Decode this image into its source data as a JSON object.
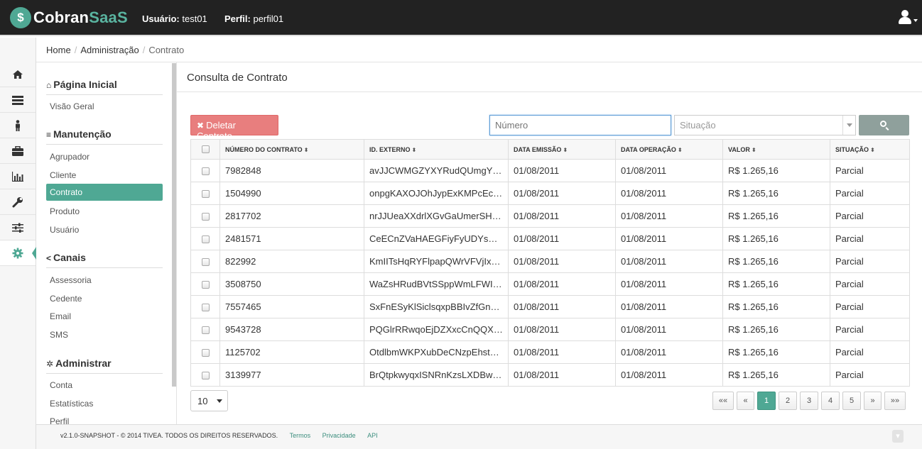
{
  "header": {
    "brand_left": "Cobran",
    "brand_right": "SaaS",
    "user_label": "Usuário:",
    "user_value": "test01",
    "profile_label": "Perfil:",
    "profile_value": "perfil01"
  },
  "rail": {
    "icons": [
      "home-icon",
      "server-icon",
      "person-icon",
      "briefcase-icon",
      "bar-chart-icon",
      "wrench-icon",
      "sliders-icon",
      "gear-icon"
    ]
  },
  "breadcrumb": {
    "home": "Home",
    "admin": "Administração",
    "current": "Contrato"
  },
  "sidebar": {
    "sec1": "Página Inicial",
    "sec1_items": [
      "Visão Geral"
    ],
    "sec2": "Manutenção",
    "sec2_items": [
      "Agrupador",
      "Cliente",
      "Contrato",
      "Produto",
      "Usuário"
    ],
    "sec3": "Canais",
    "sec3_items": [
      "Assessoria",
      "Cedente",
      "Email",
      "SMS"
    ],
    "sec4": "Administrar",
    "sec4_items": [
      "Conta",
      "Estatísticas",
      "Perfil"
    ]
  },
  "page": {
    "title": "Consulta de Contrato",
    "delete_label": "Deletar Contrato",
    "numero_placeholder": "Número",
    "situacao_placeholder": "Situação"
  },
  "table": {
    "headers": [
      "NÚMERO DO CONTRATO",
      "ID. EXTERNO",
      "DATA EMISSÃO",
      "DATA OPERAÇÃO",
      "VALOR",
      "SITUAÇÃO"
    ],
    "rows": [
      [
        "7982848",
        "avJJCWMGZYXYRudQUmgYKvR...",
        "01/08/2011",
        "01/08/2011",
        "R$ 1.265,16",
        "Parcial"
      ],
      [
        "1504990",
        "onpgKAXOJOhJypExKMPcEcLxed...",
        "01/08/2011",
        "01/08/2011",
        "R$ 1.265,16",
        "Parcial"
      ],
      [
        "2817702",
        "nrJJUeaXXdrlXGvGaUmerSHAa...",
        "01/08/2011",
        "01/08/2011",
        "R$ 1.265,16",
        "Parcial"
      ],
      [
        "2481571",
        "CeECnZVaHAEGFiyFyUDYsEddg...",
        "01/08/2011",
        "01/08/2011",
        "R$ 1.265,16",
        "Parcial"
      ],
      [
        "822992",
        "KmIITsHqRYFlpapQWrVFVjIxyDQ...",
        "01/08/2011",
        "01/08/2011",
        "R$ 1.265,16",
        "Parcial"
      ],
      [
        "3508750",
        "WaZsHRudBVtSSppWmLFWIbSE...",
        "01/08/2011",
        "01/08/2011",
        "R$ 1.265,16",
        "Parcial"
      ],
      [
        "7557465",
        "SxFnESyKlSiclsqxpBBIvZfGnOrvI...",
        "01/08/2011",
        "01/08/2011",
        "R$ 1.265,16",
        "Parcial"
      ],
      [
        "9543728",
        "PQGlrRRwqoEjDZXxcCnQQXsXq...",
        "01/08/2011",
        "01/08/2011",
        "R$ 1.265,16",
        "Parcial"
      ],
      [
        "1125702",
        "OtdlbmWKPXubDeCNzpEhstTZn...",
        "01/08/2011",
        "01/08/2011",
        "R$ 1.265,16",
        "Parcial"
      ],
      [
        "3139977",
        "BrQtpkwyqxISNRnKzsLXDBwplo...",
        "01/08/2011",
        "01/08/2011",
        "R$ 1.265,16",
        "Parcial"
      ]
    ]
  },
  "pagination": {
    "page_size": "10",
    "first": "««",
    "prev": "«",
    "pages": [
      "1",
      "2",
      "3",
      "4",
      "5"
    ],
    "next": "»",
    "last": "»»",
    "current": "1"
  },
  "footer": {
    "copyright": "v2.1.0-SNAPSHOT - © 2014 TIVEA. TODOS OS DIREITOS RESERVADOS.",
    "links": [
      "Termos",
      "Privacidade",
      "API"
    ]
  },
  "colors": {
    "accent": "#4fa894",
    "topbar": "#222222",
    "delete": "#e87e7e"
  }
}
